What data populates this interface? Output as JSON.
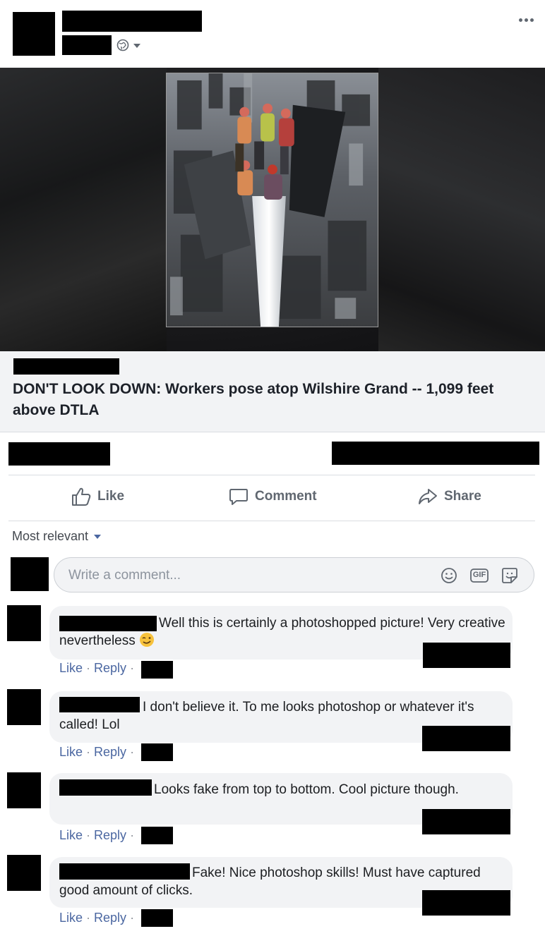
{
  "post": {
    "privacy_icon": "globe-icon",
    "more_icon": "more-options-icon"
  },
  "link_preview": {
    "title": "DON'T LOOK DOWN: Workers pose atop Wilshire Grand -- 1,099 feet above DTLA"
  },
  "actions": {
    "like_label": "Like",
    "comment_label": "Comment",
    "share_label": "Share"
  },
  "comments_section": {
    "sort_label": "Most relevant",
    "composer_placeholder": "Write a comment...",
    "gif_label": "GIF"
  },
  "comments": [
    {
      "text": "Well this is certainly a photoshopped picture! Very creative nevertheless",
      "emoji": "winking-face",
      "like": "Like",
      "reply": "Reply",
      "sep": "·"
    },
    {
      "text": "I don't believe it. To me looks photoshop or whatever it's called! Lol",
      "like": "Like",
      "reply": "Reply",
      "sep": "·"
    },
    {
      "text": "Looks fake from top to bottom. Cool picture though.",
      "like": "Like",
      "reply": "Reply",
      "sep": "·"
    },
    {
      "text": "Fake! Nice photoshop skills! Must have captured good amount of clicks.",
      "like": "Like",
      "reply": "Reply",
      "sep": "·"
    }
  ],
  "colors": {
    "link_blue": "#4b67a1",
    "bubble_gray": "#f2f3f5",
    "action_gray": "#606770"
  }
}
